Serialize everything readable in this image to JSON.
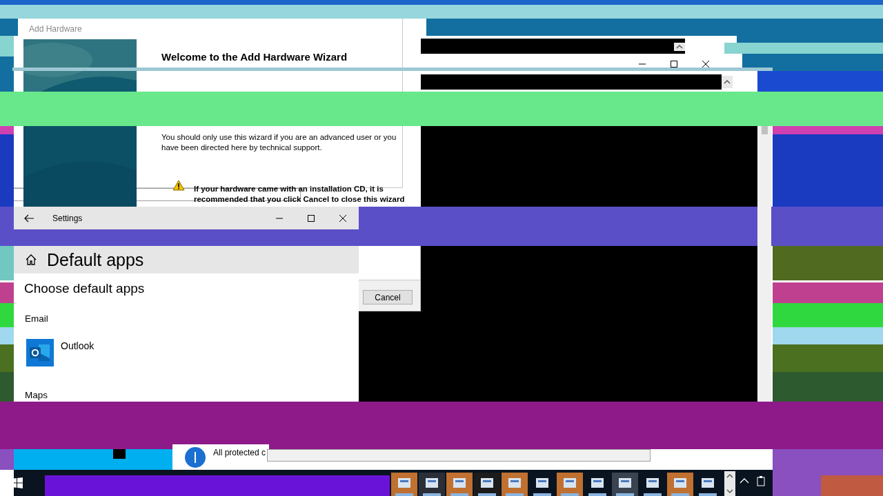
{
  "add_hardware": {
    "title": "Add Hardware",
    "heading": "Welcome to the Add Hardware Wizard",
    "body": "You should only use this wizard if you are an advanced user or you have been directed here by technical support.",
    "warning": "If your hardware came with an installation CD, it is recommended that you click Cancel to close this wizard",
    "buttons": [
      "Cancel"
    ]
  },
  "settings": {
    "title": "Settings",
    "page_title": "Default apps",
    "section": "Choose default apps",
    "categories": [
      {
        "label": "Email",
        "app": "Outlook"
      },
      {
        "label": "Maps"
      }
    ]
  },
  "notification": {
    "text": "All protected c"
  }
}
